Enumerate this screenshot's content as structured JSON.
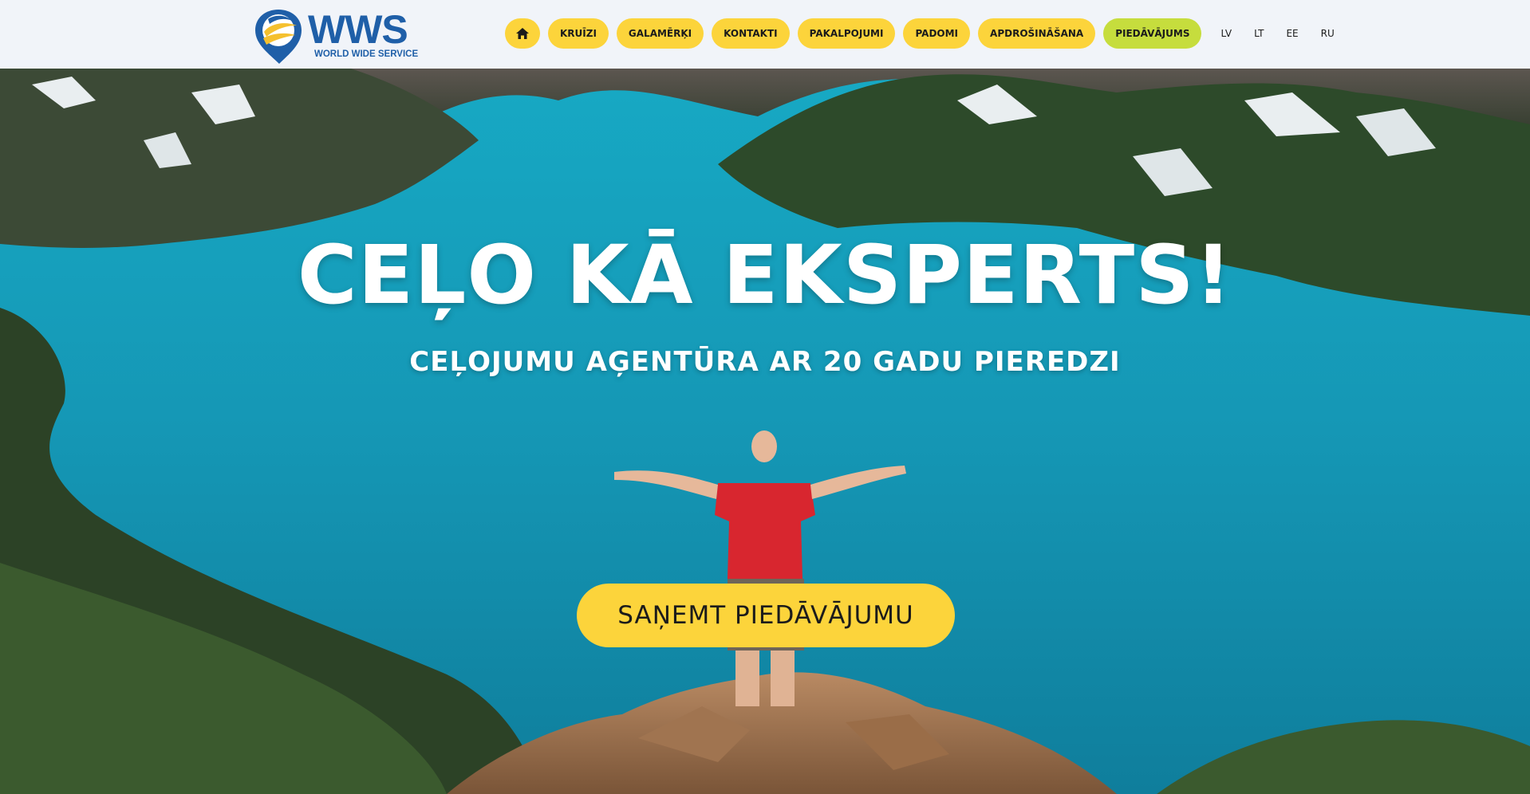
{
  "brand": {
    "name": "WWS",
    "tagline": "WORLD WIDE SERVICE",
    "primary_color": "#1f5fa8",
    "accent_color": "#f5c02e"
  },
  "nav": {
    "home_icon": "home-icon",
    "items": [
      {
        "label": "KRUĪZI"
      },
      {
        "label": "GALAMĒRĶI"
      },
      {
        "label": "KONTAKTI"
      },
      {
        "label": "PAKALPOJUMI"
      },
      {
        "label": "PADOMI"
      },
      {
        "label": "APDROŠINĀŠANA"
      },
      {
        "label": "PIEDĀVĀJUMS"
      }
    ],
    "languages": [
      "LV",
      "LT",
      "EE",
      "RU"
    ],
    "pill_color": "#fcd43b",
    "highlight_color": "#c6dd3d"
  },
  "hero": {
    "headline": "CEĻO KĀ EKSPERTS!",
    "subheadline": "CEĻOJUMU AĢENTŪRA AR 20 GADU PIEREDZI",
    "cta_label": "SAŅEMT PIEDĀVĀJUMU",
    "cta_color": "#fcd43b",
    "lake_color": "#1597b5"
  }
}
